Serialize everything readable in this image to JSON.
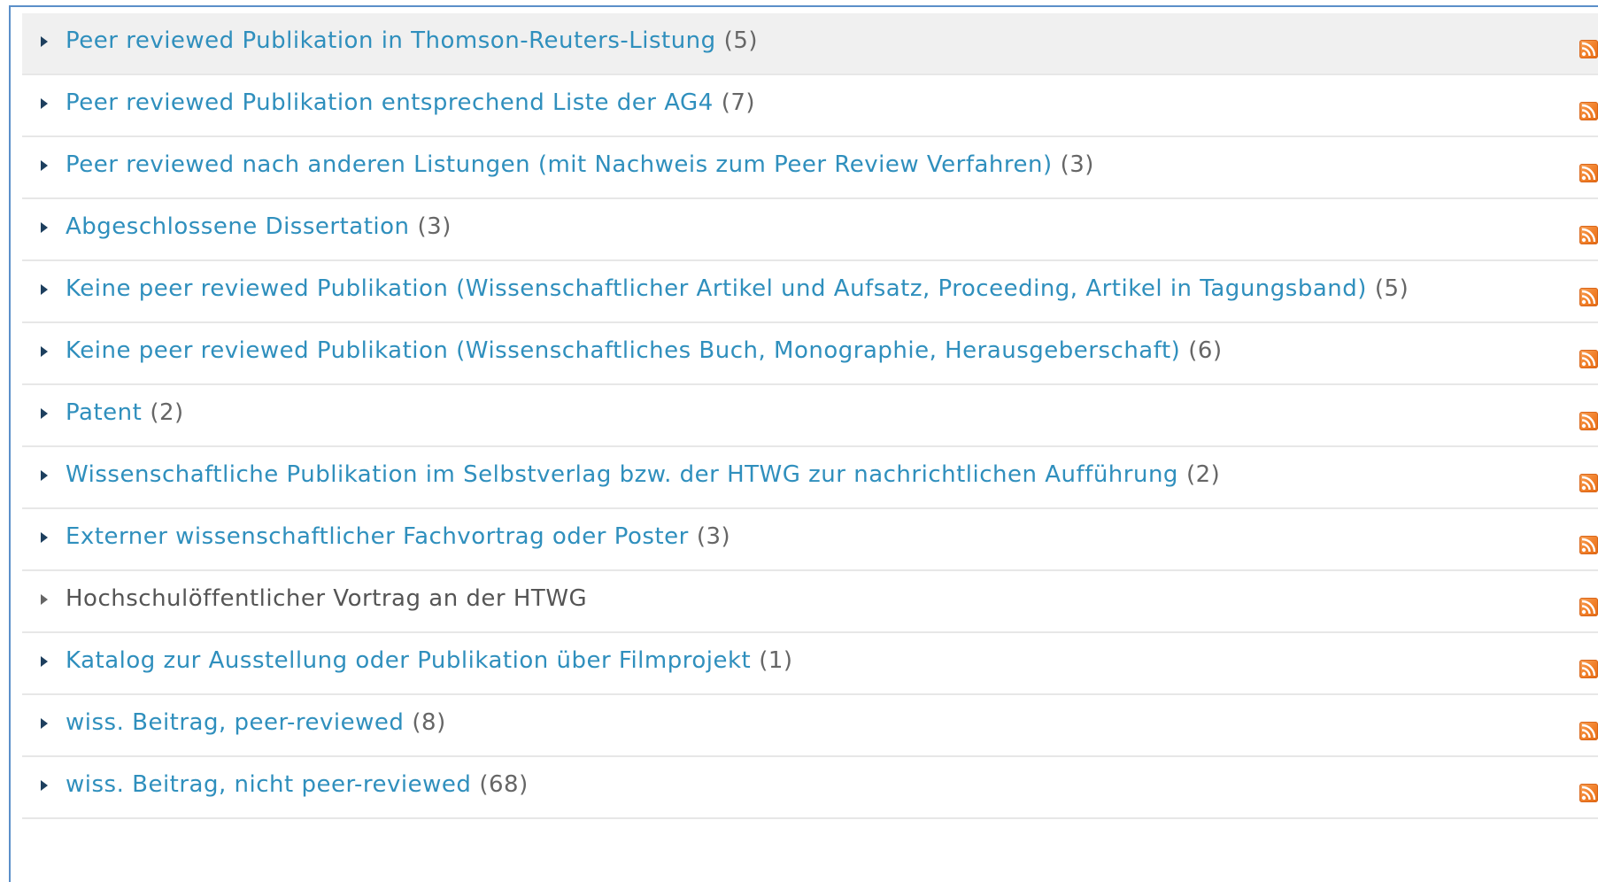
{
  "categories": [
    {
      "label": "Peer reviewed Publikation in Thomson-Reuters-Listung",
      "count": "(5)",
      "linked": true
    },
    {
      "label": "Peer reviewed Publikation entsprechend Liste der AG4",
      "count": "(7)",
      "linked": true
    },
    {
      "label": "Peer reviewed nach anderen Listungen (mit Nachweis zum Peer Review Verfahren)",
      "count": "(3)",
      "linked": true
    },
    {
      "label": "Abgeschlossene Dissertation",
      "count": "(3)",
      "linked": true
    },
    {
      "label": "Keine peer reviewed Publikation (Wissenschaftlicher Artikel und Aufsatz, Proceeding, Artikel in Tagungsband)",
      "count": "(5)",
      "linked": true
    },
    {
      "label": "Keine peer reviewed Publikation (Wissenschaftliches Buch, Monographie, Herausgeberschaft)",
      "count": "(6)",
      "linked": true
    },
    {
      "label": "Patent",
      "count": "(2)",
      "linked": true
    },
    {
      "label": "Wissenschaftliche Publikation im Selbstverlag bzw. der HTWG zur nachrichtlichen Aufführung",
      "count": "(2)",
      "linked": true
    },
    {
      "label": "Externer wissenschaftlicher Fachvortrag oder Poster",
      "count": "(3)",
      "linked": true
    },
    {
      "label": "Hochschulöffentlicher Vortrag an der HTWG",
      "count": "",
      "linked": false
    },
    {
      "label": "Katalog zur Ausstellung oder Publikation über Filmprojekt",
      "count": "(1)",
      "linked": true
    },
    {
      "label": "wiss. Beitrag, peer-reviewed",
      "count": "(8)",
      "linked": true
    },
    {
      "label": "wiss. Beitrag, nicht peer-reviewed",
      "count": "(68)",
      "linked": true
    }
  ],
  "icons": {
    "row_toggle": "triangle-right-icon",
    "feed": "rss-feed-icon"
  },
  "colors": {
    "link": "#2f8fbd",
    "count": "#666666",
    "frame_border": "#5b8fc9",
    "rss": "#f17f29",
    "first_row_bg": "#f0f0f0"
  }
}
